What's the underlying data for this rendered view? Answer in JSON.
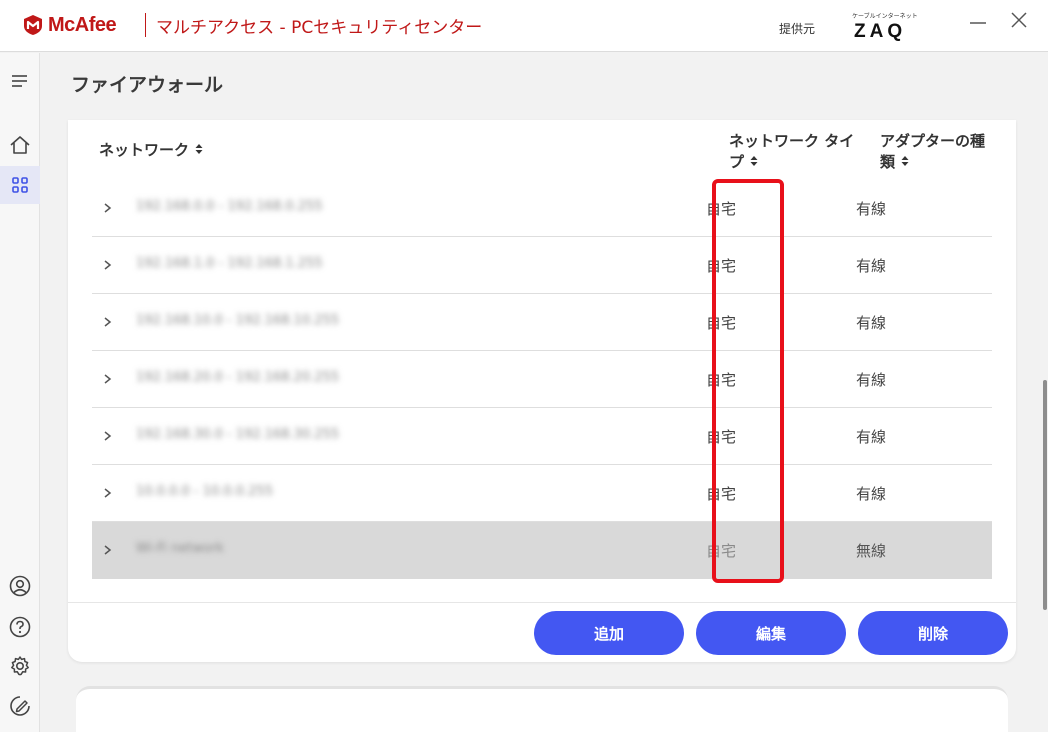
{
  "app": {
    "brand": "McAfee",
    "title": "マルチアクセス - PCセキュリティセンター",
    "provided_by": "提供元",
    "provider_small": "ケーブルインターネット",
    "provider_logo": "ZAQ",
    "brand_color": "#c01818"
  },
  "window_controls": [
    "minimize-icon",
    "close-icon"
  ],
  "sidebar": {
    "items": [
      {
        "icon": "menu-icon"
      },
      {
        "icon": "home-icon"
      },
      {
        "icon": "apps-grid-icon",
        "active": true
      },
      {
        "icon": "account-icon"
      },
      {
        "icon": "help-icon"
      },
      {
        "icon": "settings-icon"
      },
      {
        "icon": "feedback-icon"
      }
    ]
  },
  "page": {
    "title": "ファイアウォール"
  },
  "table": {
    "headers": {
      "network": "ネットワーク",
      "network_type": "ネットワーク タイプ",
      "adapter_type": "アダプターの種類"
    },
    "rows": [
      {
        "name": "192.168.0.0 - 192.168.0.255",
        "type": "自宅",
        "adapter": "有線"
      },
      {
        "name": "192.168.1.0 - 192.168.1.255",
        "type": "自宅",
        "adapter": "有線"
      },
      {
        "name": "192.168.10.0 - 192.168.10.255",
        "type": "自宅",
        "adapter": "有線"
      },
      {
        "name": "192.168.20.0 - 192.168.20.255",
        "type": "自宅",
        "adapter": "有線"
      },
      {
        "name": "192.168.30.0 - 192.168.30.255",
        "type": "自宅",
        "adapter": "有線"
      },
      {
        "name": "10.0.0.0 - 10.0.0.255",
        "type": "自宅",
        "adapter": "有線"
      },
      {
        "name": "Wi-Fi network",
        "type": "自宅",
        "adapter": "無線",
        "selected": true
      }
    ]
  },
  "actions": {
    "add": "追加",
    "edit": "編集",
    "delete": "削除"
  },
  "colors": {
    "accent": "#4357f2",
    "highlight": "#e8101a"
  }
}
